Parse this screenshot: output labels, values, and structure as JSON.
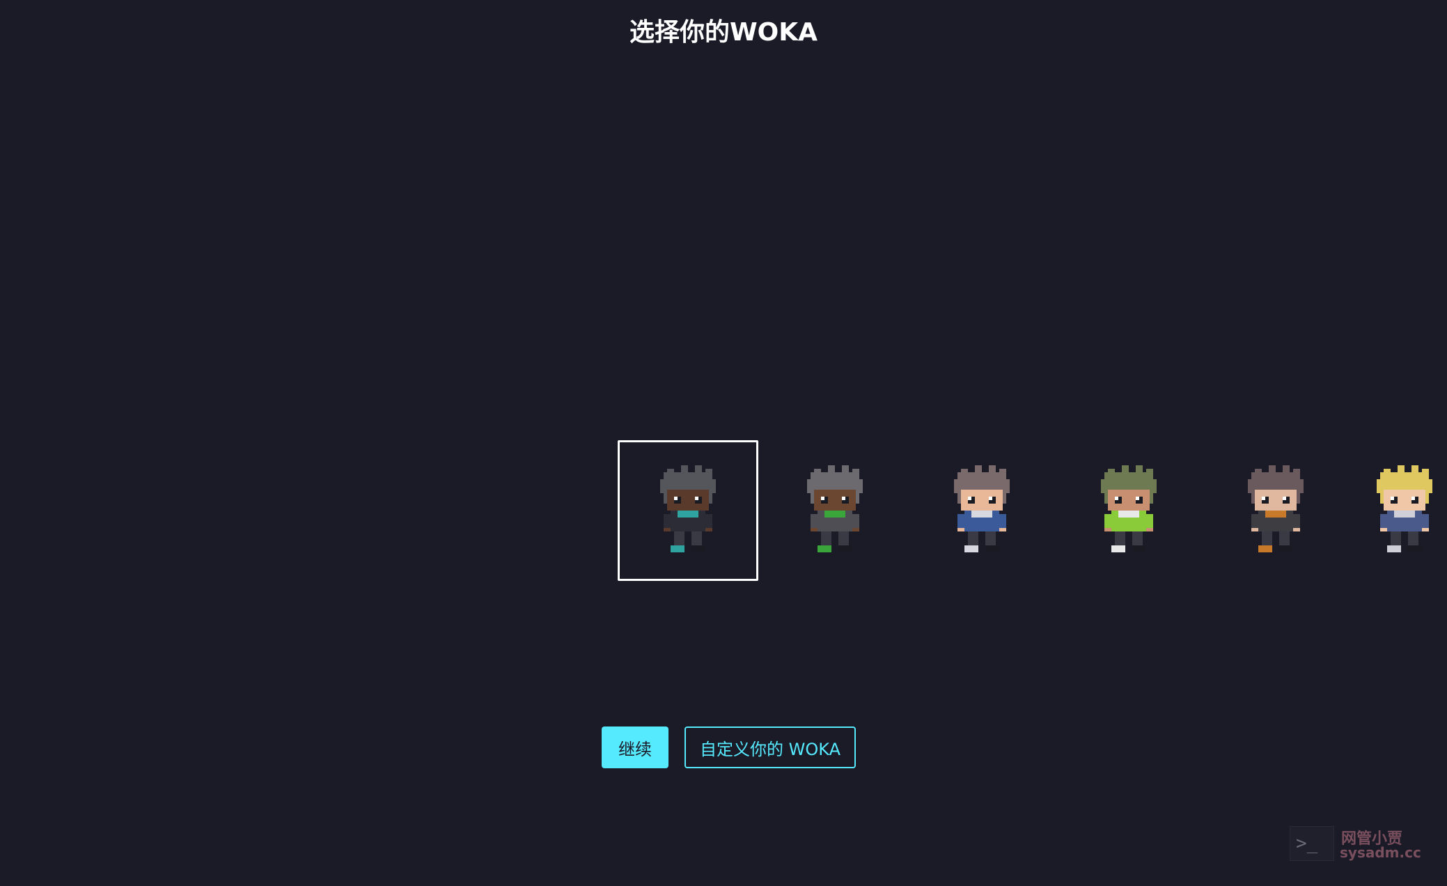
{
  "title": "选择你的WOKA",
  "wokas": [
    {
      "name": "woka-1",
      "skin": "#5a3a2a",
      "hair": "#55555c",
      "shirt": "#2c2c36",
      "accent": "#2fa3a0",
      "selected": true
    },
    {
      "name": "woka-2",
      "skin": "#6b4630",
      "hair": "#6c6a6e",
      "shirt": "#4e4e54",
      "accent": "#3aa53a",
      "selected": false
    },
    {
      "name": "woka-3",
      "skin": "#e8b898",
      "hair": "#7a6a6c",
      "shirt": "#3a5a9a",
      "accent": "#d8d8e0",
      "selected": false
    },
    {
      "name": "woka-4",
      "skin": "#c89070",
      "hair": "#6e7a52",
      "shirt": "#8acb3a",
      "accent": "#e8e8e8",
      "selected": false
    },
    {
      "name": "woka-5",
      "skin": "#e0b8a0",
      "hair": "#6a5a5e",
      "shirt": "#3e3e42",
      "accent": "#c87a2a",
      "selected": false
    },
    {
      "name": "woka-6",
      "skin": "#f0c8a8",
      "hair": "#e0c860",
      "shirt": "#4a5a8a",
      "accent": "#d0d0d8",
      "selected": false
    }
  ],
  "buttons": {
    "continue_label": "继续",
    "customize_label": "自定义你的 WOKA"
  },
  "watermark": {
    "prompt": ">_",
    "line1": "网管小贾",
    "line2": "sysadm.cc"
  }
}
